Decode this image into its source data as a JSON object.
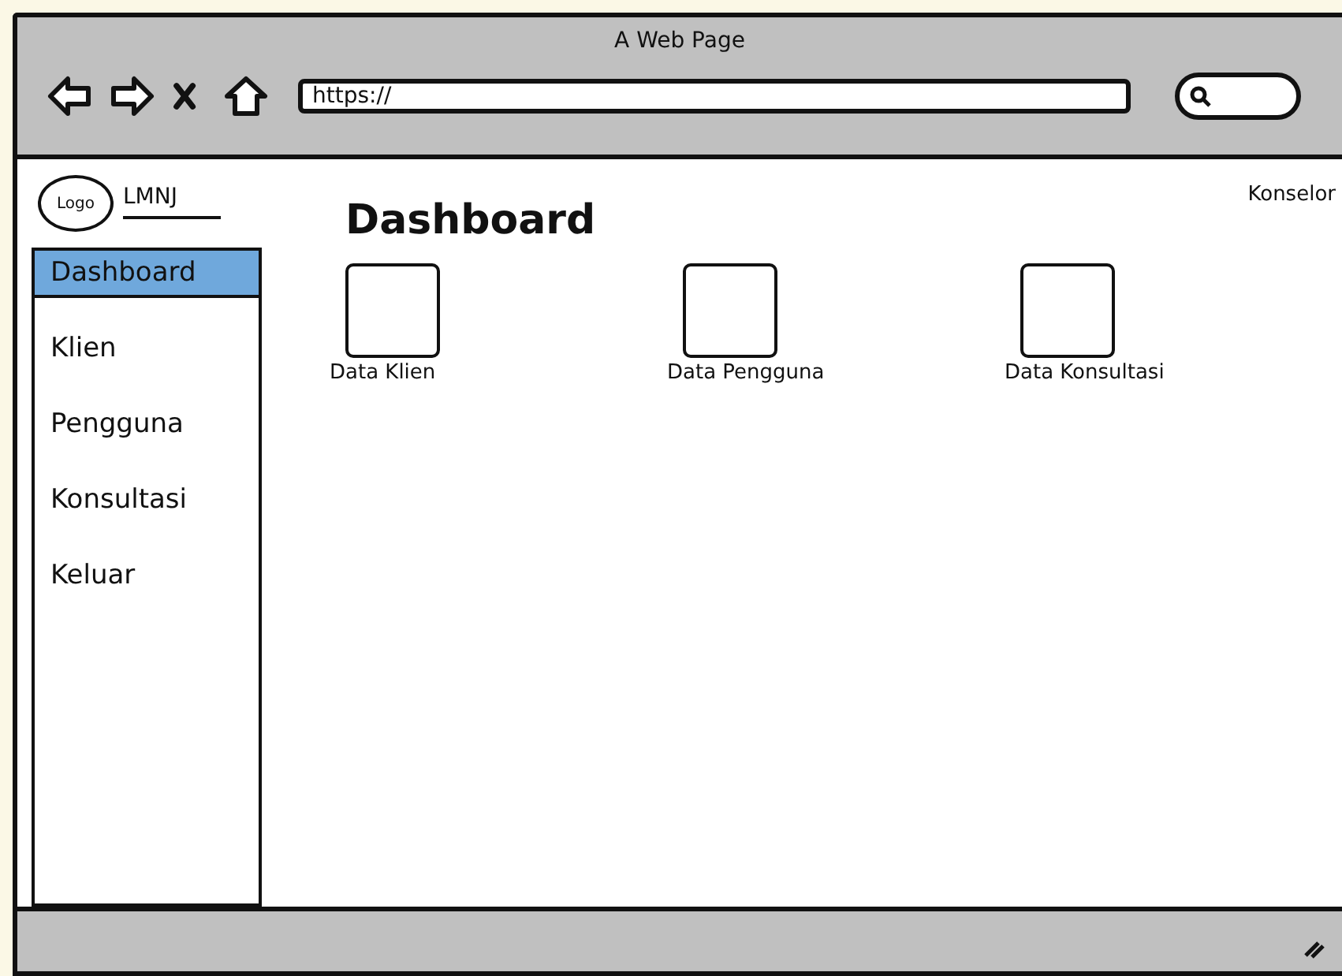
{
  "window": {
    "title": "A Web Page"
  },
  "address_bar": {
    "value": "https://"
  },
  "brand": {
    "logo": "Logo",
    "name": "LMNJ"
  },
  "menu": [
    {
      "label": "Dashboard",
      "selected": true
    },
    {
      "label": "Klien",
      "selected": false
    },
    {
      "label": "Pengguna",
      "selected": false
    },
    {
      "label": "Konsultasi",
      "selected": false
    },
    {
      "label": "Keluar",
      "selected": false
    }
  ],
  "page": {
    "heading": "Dashboard",
    "user": "Konselor",
    "tiles": [
      {
        "label": "Data Klien"
      },
      {
        "label": "Data Pengguna"
      },
      {
        "label": "Data Konsultasi"
      }
    ]
  }
}
